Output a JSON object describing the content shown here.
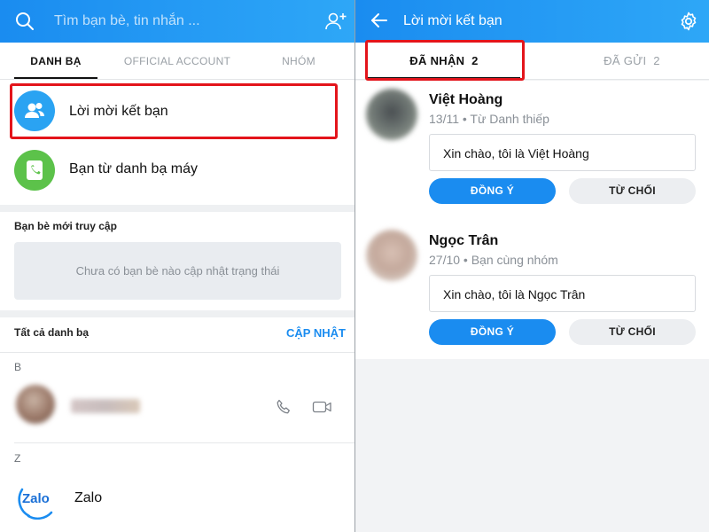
{
  "left": {
    "search": {
      "placeholder": "Tìm bạn bè, tin nhắn ..."
    },
    "tabs": [
      {
        "label": "DANH BẠ",
        "active": true
      },
      {
        "label": "OFFICIAL ACCOUNT",
        "active": false
      },
      {
        "label": "NHÓM",
        "active": false
      }
    ],
    "menu": {
      "friend_requests": "Lời mời kết bạn",
      "phone_contacts": "Bạn từ danh bạ máy"
    },
    "recent": {
      "title": "Bạn bè mới truy cập",
      "empty_text": "Chưa có bạn bè nào cập nhật trạng thái"
    },
    "all_contacts": {
      "title": "Tất cả danh bạ",
      "update_label": "CẬP NHẬT",
      "groups": [
        {
          "letter": "B"
        },
        {
          "letter": "Z",
          "contact_name": "Zalo",
          "logo_text": "Zalo"
        }
      ]
    }
  },
  "right": {
    "title": "Lời mời kết bạn",
    "tabs": [
      {
        "label": "ĐÃ NHẬN",
        "count": "2",
        "active": true
      },
      {
        "label": "ĐÃ GỬI",
        "count": "2",
        "active": false
      }
    ],
    "requests": [
      {
        "name": "Việt Hoàng",
        "meta": "13/11 • Từ Danh thiếp",
        "message": "Xin chào, tôi là Việt Hoàng",
        "accept": "ĐỒNG Ý",
        "decline": "TỪ CHỐI"
      },
      {
        "name": "Ngọc Trân",
        "meta": "27/10 • Bạn cùng nhóm",
        "message": "Xin chào, tôi là Ngọc Trân",
        "accept": "ĐỒNG Ý",
        "decline": "TỪ CHỐI"
      }
    ]
  },
  "colors": {
    "brand_blue": "#1a8cf0",
    "header_gradient_end": "#2ea7f7",
    "highlight_red": "#e3141b",
    "contacts_icon_bg": "#2aa3f2",
    "phone_icon_bg": "#5cc24a"
  },
  "icons": {
    "search": "search-icon",
    "add_friend": "add-friend-icon",
    "back": "back-arrow-icon",
    "settings": "gear-icon",
    "contacts": "contacts-icon",
    "phone_book": "phone-contacts-icon",
    "call": "phone-icon",
    "video": "video-icon"
  }
}
